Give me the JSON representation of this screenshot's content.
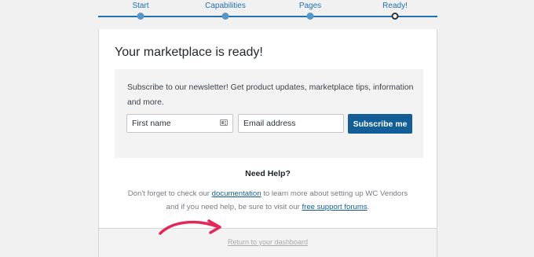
{
  "steps": [
    {
      "label": "Start"
    },
    {
      "label": "Capabilities"
    },
    {
      "label": "Pages"
    },
    {
      "label": "Ready!"
    }
  ],
  "panel": {
    "title": "Your marketplace is ready!"
  },
  "newsletter": {
    "text": "Subscribe to our newsletter! Get product updates, marketplace tips, information and more.",
    "first_name_placeholder": "First name",
    "email_placeholder": "Email address",
    "subscribe_label": "Subscribe me"
  },
  "help": {
    "title": "Need Help?",
    "line1_before": "Don't forget to check our ",
    "documentation_link": "documentation",
    "line1_after": " to learn more about setting up WC Vendors",
    "line2_before": "and if you need help, be sure to visit our ",
    "forums_link": "free support forums",
    "line2_after": "."
  },
  "footer": {
    "return_link": "Return to your dashboard"
  },
  "colors": {
    "accent": "#2271b1",
    "button": "#135e96",
    "annotation_arrow": "#e2285b"
  }
}
